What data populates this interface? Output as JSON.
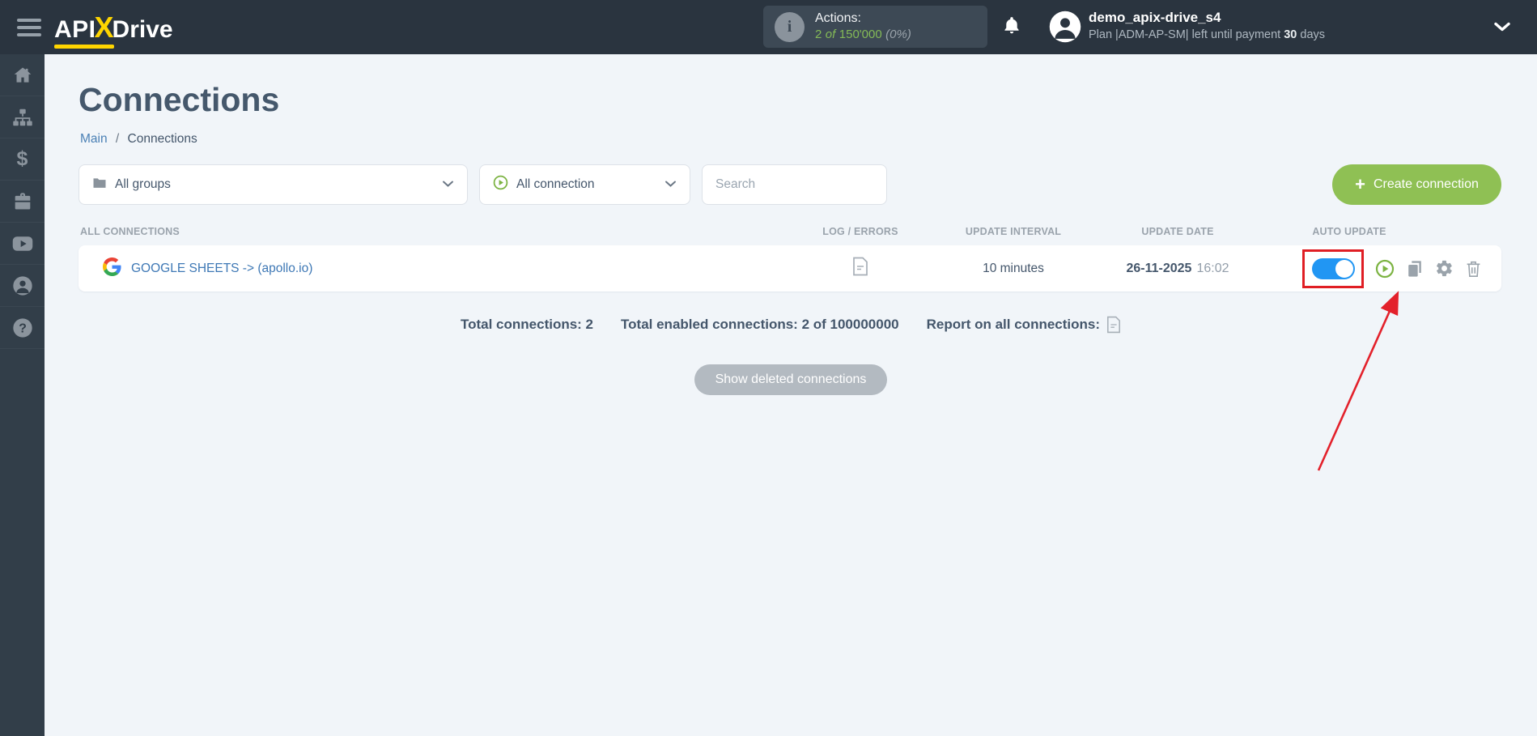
{
  "header": {
    "logo": {
      "part_api": "API",
      "part_x": "X",
      "part_drive": "Drive"
    },
    "actions": {
      "label": "Actions:",
      "used": "2",
      "of": "of",
      "total": "150'000",
      "percent": "(0%)"
    },
    "user": {
      "name": "demo_apix-drive_s4",
      "plan_prefix": "Plan |ADM-AP-SM| left until payment",
      "days_value": "30",
      "days_suffix": "days"
    }
  },
  "sidebar": {
    "icons": [
      "home-icon",
      "sitemap-icon",
      "dollar-icon",
      "briefcase-icon",
      "video-icon",
      "person-icon",
      "help-icon"
    ]
  },
  "page": {
    "title": "Connections",
    "breadcrumb": {
      "main": "Main",
      "sep": "/",
      "current": "Connections"
    }
  },
  "filters": {
    "groups_label": "All groups",
    "connection_label": "All connection",
    "search_placeholder": "Search",
    "create_label": "Create connection",
    "create_plus": "+"
  },
  "table": {
    "headers": [
      "ALL CONNECTIONS",
      "LOG / ERRORS",
      "UPDATE INTERVAL",
      "UPDATE DATE",
      "AUTO UPDATE"
    ],
    "rows": [
      {
        "name": "GOOGLE SHEETS -> (apollo.io)",
        "interval": "10 minutes",
        "date": "26-11-2025",
        "time": "16:02",
        "auto_update_on": true
      }
    ]
  },
  "summary": {
    "total": "Total connections: 2",
    "enabled": "Total enabled connections: 2 of 100000000",
    "report": "Report on all connections:"
  },
  "footer": {
    "show_deleted": "Show deleted connections"
  },
  "colors": {
    "topbar_bg": "#2a343f",
    "sidebar_bg": "#323e49",
    "accent_green": "#8fc054",
    "link_blue": "#3e78b5",
    "toggle_blue": "#2196f3",
    "highlight_red": "#e01e24",
    "logo_yellow": "#ffd500",
    "page_bg": "#f1f5f9"
  }
}
